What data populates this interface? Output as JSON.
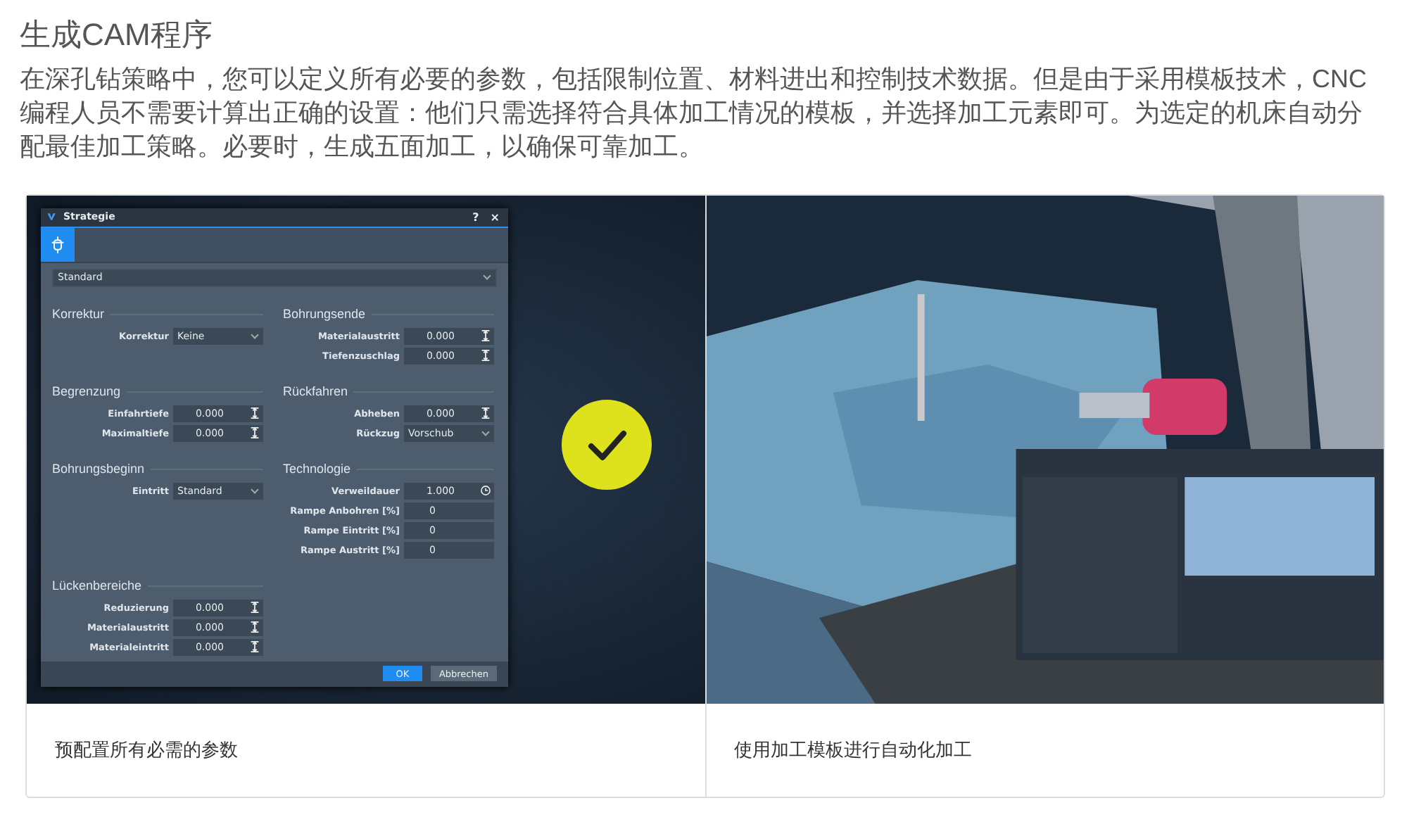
{
  "title": "生成CAM程序",
  "paragraph": "在深孔钻策略中，您可以定义所有必要的参数，包括限制位置、材料进出和控制技术数据。但是由于采用模板技术，CNC编程人员不需要计算出正确的设置：他们只需选择符合具体加工情况的模板，并选择加工元素即可。为选定的机床自动分配最佳加工策略。必要时，生成五面加工，以确保可靠加工。",
  "cards": [
    {
      "kind": "dialog",
      "caption": "预配置所有必需的参数",
      "dialog": {
        "title": "Strategie",
        "help": "?",
        "close": "×",
        "tab": {
          "selected": true
        },
        "preset": "Standard",
        "rows": [
          {
            "left": {
              "heading": "Korrektur",
              "fields": [
                {
                  "label": "Korrektur",
                  "value": "Keine",
                  "kind": "select"
                }
              ]
            },
            "right": {
              "heading": "Bohrungsende",
              "fields": [
                {
                  "label": "Materialaustritt",
                  "value": "0.000",
                  "kind": "spin"
                },
                {
                  "label": "Tiefenzuschlag",
                  "value": "0.000",
                  "kind": "spin"
                }
              ]
            }
          },
          {
            "left": {
              "heading": "Begrenzung",
              "fields": [
                {
                  "label": "Einfahrtiefe",
                  "value": "0.000",
                  "kind": "spin"
                },
                {
                  "label": "Maximaltiefe",
                  "value": "0.000",
                  "kind": "spin"
                }
              ]
            },
            "right": {
              "heading": "Rückfahren",
              "fields": [
                {
                  "label": "Abheben",
                  "value": "0.000",
                  "kind": "spin"
                },
                {
                  "label": "Rückzug",
                  "value": "Vorschub",
                  "kind": "select"
                }
              ]
            }
          },
          {
            "left": {
              "heading": "Bohrungsbeginn",
              "fields": [
                {
                  "label": "Eintritt",
                  "value": "Standard",
                  "kind": "select"
                }
              ]
            },
            "right": {
              "heading": "Technologie",
              "fields": [
                {
                  "label": "Verweildauer",
                  "value": "1.000",
                  "kind": "timer"
                },
                {
                  "label": "Rampe Anbohren [%]",
                  "value": "0",
                  "kind": "plain"
                },
                {
                  "label": "Rampe Eintritt [%]",
                  "value": "0",
                  "kind": "plain"
                },
                {
                  "label": "Rampe Austritt [%]",
                  "value": "0",
                  "kind": "plain"
                }
              ]
            }
          },
          {
            "left": {
              "heading": "Lückenbereiche",
              "fields": [
                {
                  "label": "Reduzierung",
                  "value": "0.000",
                  "kind": "spin"
                },
                {
                  "label": "Materialaustritt",
                  "value": "0.000",
                  "kind": "spin"
                },
                {
                  "label": "Materialeintritt",
                  "value": "0.000",
                  "kind": "spin"
                }
              ]
            }
          }
        ],
        "buttons": [
          {
            "label": "OK",
            "kind": "primary"
          },
          {
            "label": "Abbrechen",
            "kind": "secondary"
          }
        ]
      }
    },
    {
      "kind": "picture",
      "caption": "使用加工模板进行自动化加工"
    }
  ]
}
